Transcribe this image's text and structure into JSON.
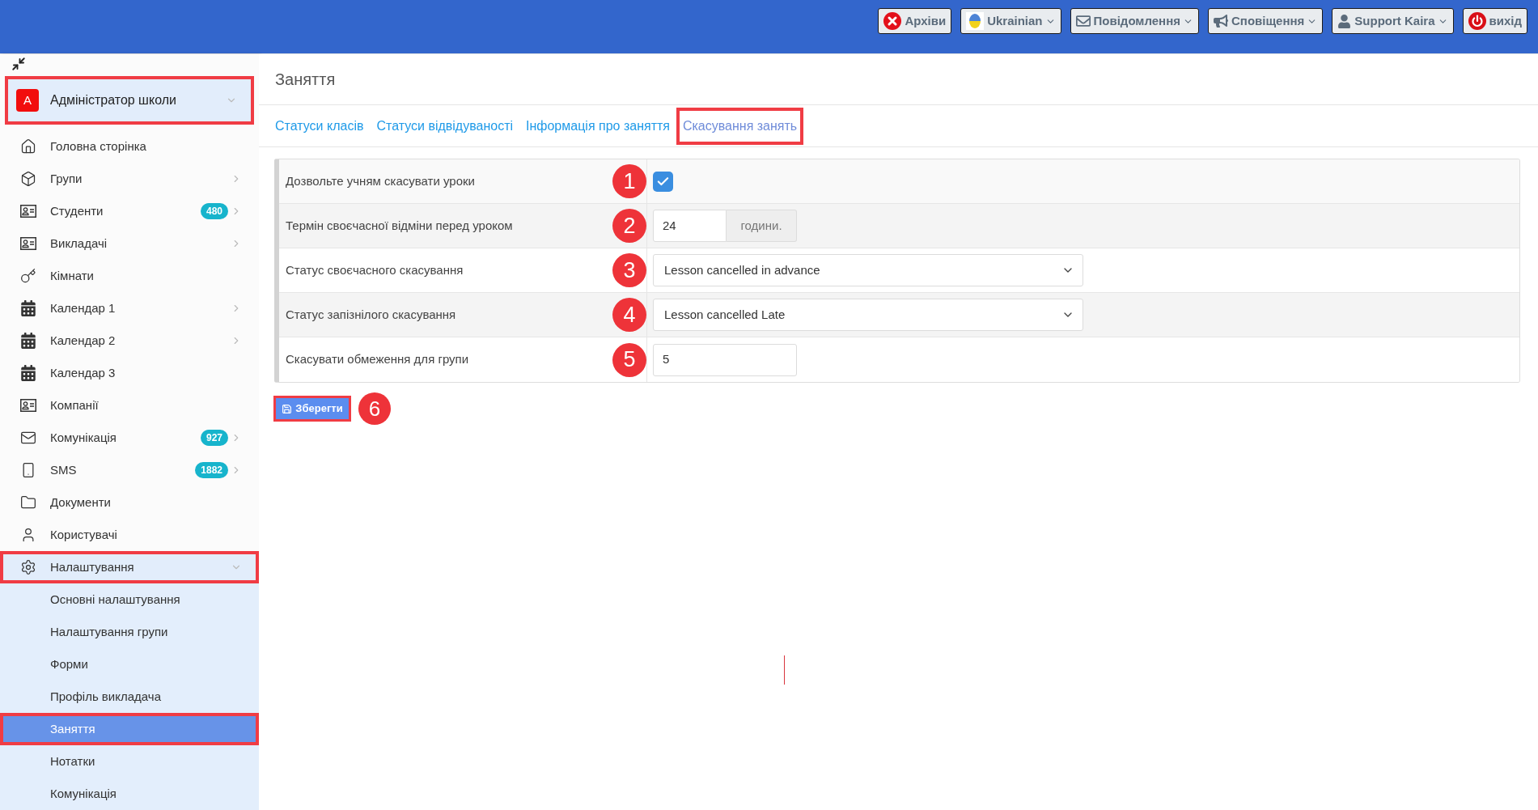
{
  "top_bar": {
    "buttons": [
      {
        "kind": "archive",
        "label": "Архіви",
        "dropdown": false
      },
      {
        "kind": "language",
        "label": "Ukrainian",
        "dropdown": true
      },
      {
        "kind": "messages",
        "label": "Повідомлення",
        "dropdown": true
      },
      {
        "kind": "notifications",
        "label": "Сповіщення",
        "dropdown": true
      },
      {
        "kind": "user",
        "label": "Support Kaira",
        "dropdown": true
      },
      {
        "kind": "logout",
        "label": "вихід",
        "dropdown": false
      }
    ]
  },
  "sidebar": {
    "account": {
      "initial": "A",
      "name": "Адміністратор школи",
      "highlighted": true
    },
    "items": [
      {
        "kind": "link",
        "label": "Головна сторінка",
        "highlighted": false
      },
      {
        "kind": "menu",
        "label": "Групи",
        "expanded": false,
        "highlighted": false
      },
      {
        "kind": "menu",
        "label": "Студенти",
        "badge": "480",
        "expanded": false,
        "highlighted": false
      },
      {
        "kind": "menu",
        "label": "Викладачі",
        "expanded": false,
        "highlighted": false
      },
      {
        "kind": "link",
        "label": "Кімнати",
        "highlighted": false
      },
      {
        "kind": "menu",
        "label": "Календар 1",
        "expanded": false,
        "highlighted": false
      },
      {
        "kind": "menu",
        "label": "Календар 2",
        "expanded": false,
        "highlighted": false
      },
      {
        "kind": "link",
        "label": "Календар 3",
        "highlighted": false
      },
      {
        "kind": "link",
        "label": "Компанії",
        "highlighted": false
      },
      {
        "kind": "menu",
        "label": "Комунікація",
        "badge": "927",
        "expanded": false,
        "highlighted": false
      },
      {
        "kind": "menu",
        "label": "SMS",
        "badge": "1882",
        "expanded": false,
        "highlighted": false
      },
      {
        "kind": "link",
        "label": "Документи",
        "highlighted": false
      },
      {
        "kind": "link",
        "label": "Користувачі",
        "highlighted": false
      },
      {
        "kind": "menu",
        "label": "Налаштування",
        "expanded": true,
        "highlighted": true,
        "children": [
          {
            "label": "Основні налаштування",
            "selected": false,
            "highlighted": false
          },
          {
            "label": "Налаштування групи",
            "selected": false,
            "highlighted": false
          },
          {
            "label": "Форми",
            "selected": false,
            "highlighted": false
          },
          {
            "label": "Профіль викладача",
            "selected": false,
            "highlighted": false
          },
          {
            "label": "Заняття",
            "selected": true,
            "highlighted": true
          },
          {
            "label": "Нотатки",
            "selected": false,
            "highlighted": false
          },
          {
            "label": "Комунікація",
            "selected": false,
            "highlighted": false
          }
        ]
      }
    ]
  },
  "page": {
    "title": "Заняття",
    "tabs": [
      {
        "label": "Статуси класів",
        "selected": false,
        "highlighted": false
      },
      {
        "label": "Статуси відвідуваності",
        "selected": false,
        "highlighted": false
      },
      {
        "label": "Інформація про заняття",
        "selected": false,
        "highlighted": false
      },
      {
        "label": "Скасування занять",
        "selected": true,
        "highlighted": true
      }
    ],
    "form": {
      "rows": [
        {
          "kind": "checkbox",
          "label": "Дозвольте учням скасувати уроки",
          "marker": "1",
          "checked": true
        },
        {
          "kind": "number_unit",
          "label": "Термін своєчасної відміни перед уроком",
          "marker": "2",
          "value": "24",
          "unit": "години."
        },
        {
          "kind": "select",
          "label": "Статус своєчасного скасування",
          "marker": "3",
          "value": "Lesson cancelled in advance"
        },
        {
          "kind": "select",
          "label": "Статус запізнілого скасування",
          "marker": "4",
          "value": "Lesson cancelled Late"
        },
        {
          "kind": "input",
          "label": "Скасувати обмеження для групи",
          "marker": "5",
          "value": "5"
        }
      ]
    },
    "save_button": {
      "label": "Зберегти",
      "highlighted": true,
      "marker": "6"
    }
  }
}
